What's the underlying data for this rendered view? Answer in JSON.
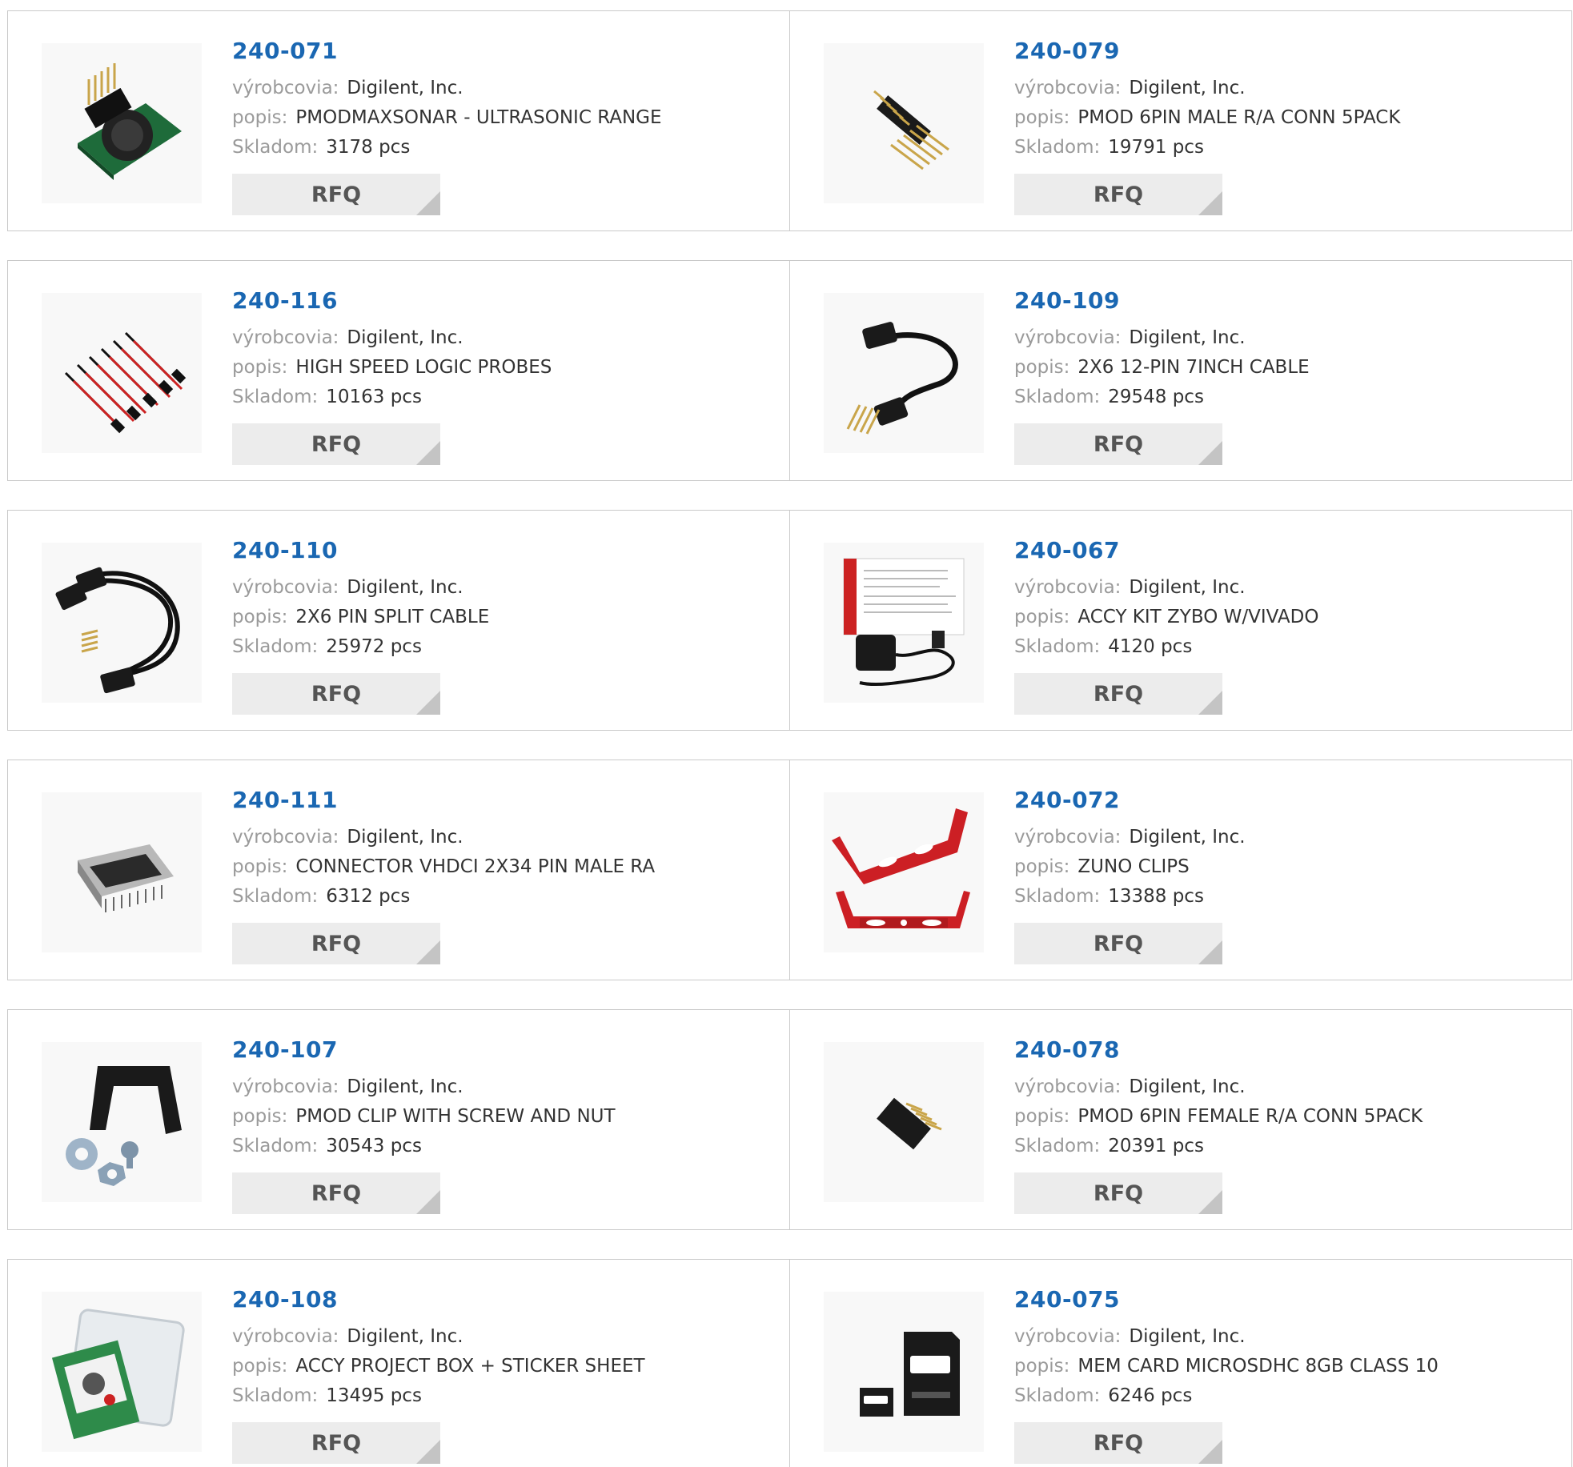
{
  "labels": {
    "manufacturer": "výrobcovia:",
    "description": "popis:",
    "stock": "Skladom:",
    "rfq": "RFQ"
  },
  "colors": {
    "part_number": "#1a67b2",
    "label": "#9a9a9a",
    "value": "#333333",
    "button_bg": "#ececec",
    "border": "#c9c9c9"
  },
  "products": [
    {
      "part_number": "240-071",
      "manufacturer": "Digilent, Inc.",
      "description": "PMODMAXSONAR - ULTRASONIC RANGE",
      "stock": "3178 pcs",
      "image": "ultrasonic-sensor-image"
    },
    {
      "part_number": "240-079",
      "manufacturer": "Digilent, Inc.",
      "description": "PMOD 6PIN MALE R/A CONN 5PACK",
      "stock": "19791 pcs",
      "image": "male-header-image"
    },
    {
      "part_number": "240-116",
      "manufacturer": "Digilent, Inc.",
      "description": "HIGH SPEED LOGIC PROBES",
      "stock": "10163 pcs",
      "image": "logic-probes-image"
    },
    {
      "part_number": "240-109",
      "manufacturer": "Digilent, Inc.",
      "description": "2X6 12-PIN 7INCH CABLE",
      "stock": "29548 pcs",
      "image": "cable-image"
    },
    {
      "part_number": "240-110",
      "manufacturer": "Digilent, Inc.",
      "description": "2X6 PIN SPLIT CABLE",
      "stock": "25972 pcs",
      "image": "split-cable-image"
    },
    {
      "part_number": "240-067",
      "manufacturer": "Digilent, Inc.",
      "description": "ACCY KIT ZYBO W/VIVADO",
      "stock": "4120 pcs",
      "image": "accessory-kit-image"
    },
    {
      "part_number": "240-111",
      "manufacturer": "Digilent, Inc.",
      "description": "CONNECTOR VHDCI 2X34 PIN MALE RA",
      "stock": "6312 pcs",
      "image": "vhdci-connector-image"
    },
    {
      "part_number": "240-072",
      "manufacturer": "Digilent, Inc.",
      "description": "ZUNO CLIPS",
      "stock": "13388 pcs",
      "image": "red-clips-image"
    },
    {
      "part_number": "240-107",
      "manufacturer": "Digilent, Inc.",
      "description": "PMOD CLIP WITH SCREW AND NUT",
      "stock": "30543 pcs",
      "image": "clip-screw-nut-image"
    },
    {
      "part_number": "240-078",
      "manufacturer": "Digilent, Inc.",
      "description": "PMOD 6PIN FEMALE R/A CONN 5PACK",
      "stock": "20391 pcs",
      "image": "female-header-image"
    },
    {
      "part_number": "240-108",
      "manufacturer": "Digilent, Inc.",
      "description": "ACCY PROJECT BOX + STICKER SHEET",
      "stock": "13495 pcs",
      "image": "project-box-image"
    },
    {
      "part_number": "240-075",
      "manufacturer": "Digilent, Inc.",
      "description": "MEM CARD MICROSDHC 8GB CLASS 10",
      "stock": "6246 pcs",
      "image": "microsd-card-image"
    }
  ]
}
